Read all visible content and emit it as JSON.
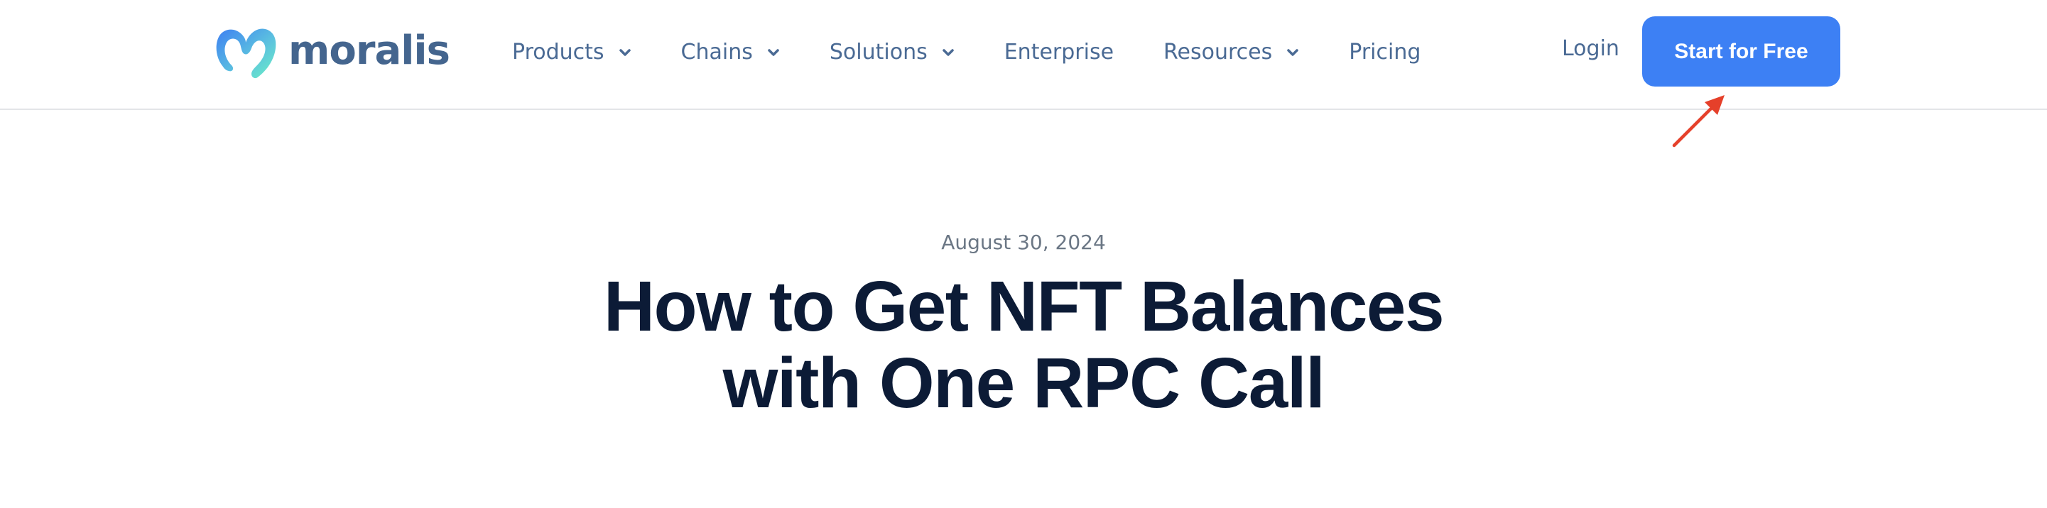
{
  "header": {
    "logo": {
      "icon": "moralis-logo-icon",
      "wordmark": "moralis"
    },
    "nav": [
      {
        "label": "Products",
        "has_dropdown": true
      },
      {
        "label": "Chains",
        "has_dropdown": true
      },
      {
        "label": "Solutions",
        "has_dropdown": true
      },
      {
        "label": "Enterprise",
        "has_dropdown": false
      },
      {
        "label": "Resources",
        "has_dropdown": true
      },
      {
        "label": "Pricing",
        "has_dropdown": false
      }
    ],
    "login_label": "Login",
    "cta_label": "Start for Free"
  },
  "article": {
    "date": "August 30, 2024",
    "title_lines": [
      "How to Get NFT Balances",
      "with One RPC Call"
    ]
  },
  "annotation": {
    "type": "arrow",
    "target": "start-for-free-button",
    "color": "#e5402a"
  },
  "colors": {
    "brand_blue": "#3d80f4",
    "nav_text": "#4a6a94",
    "title_text": "#0c1b36",
    "date_text": "#6b7785",
    "logo_text": "#44658e"
  }
}
